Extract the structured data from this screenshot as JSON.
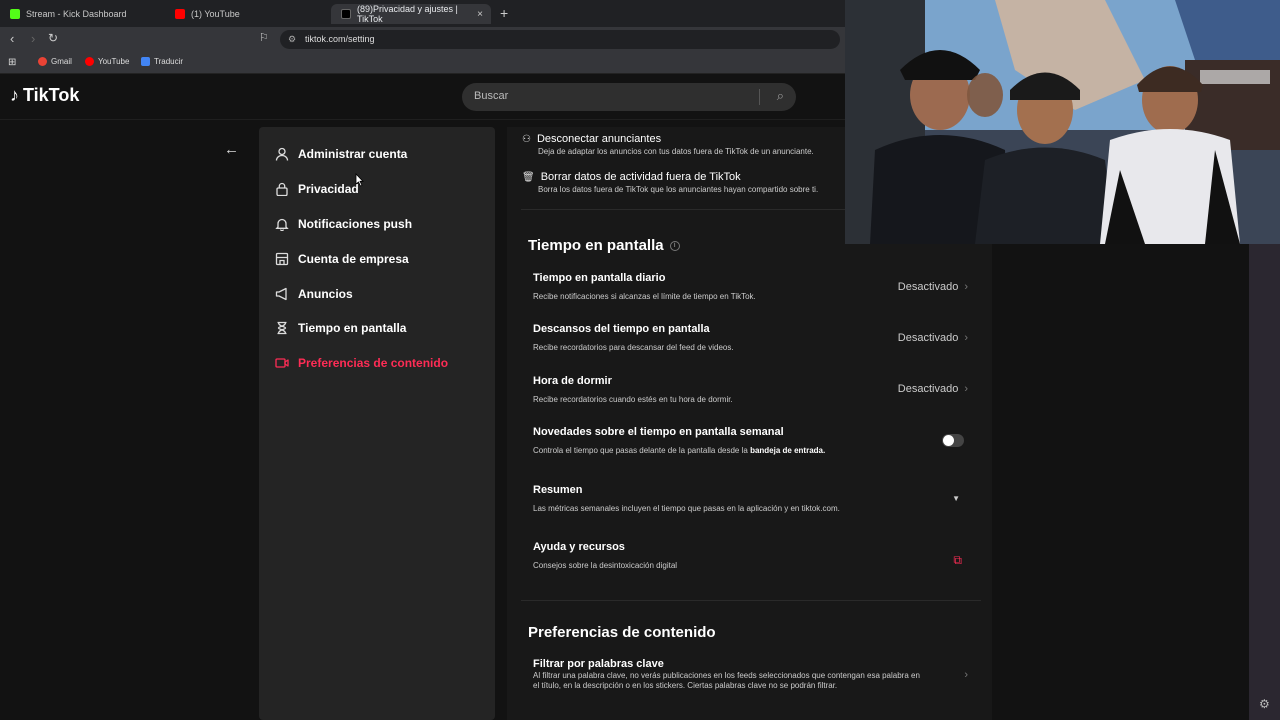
{
  "browser": {
    "tabs": [
      {
        "title": "Stream - Kick Dashboard",
        "color": "#53fc18"
      },
      {
        "title": "(1) YouTube",
        "color": "#ff0000"
      },
      {
        "title": "(89)Privacidad y ajustes | TikTok",
        "color": "#000000"
      }
    ],
    "new_tab": "+",
    "close": "×",
    "url": "tiktok.com/setting",
    "bookmarks": [
      {
        "label": "Gmail",
        "color": "#ea4335"
      },
      {
        "label": "YouTube",
        "color": "#ff0000"
      },
      {
        "label": "Traducir",
        "color": "#4285f4"
      }
    ]
  },
  "header": {
    "logo": "TikTok",
    "search_placeholder": "Buscar"
  },
  "sidebar": {
    "items": [
      {
        "label": "Administrar cuenta",
        "icon": "user-icon"
      },
      {
        "label": "Privacidad",
        "icon": "lock-icon"
      },
      {
        "label": "Notificaciones push",
        "icon": "bell-icon"
      },
      {
        "label": "Cuenta de empresa",
        "icon": "store-icon"
      },
      {
        "label": "Anuncios",
        "icon": "megaphone-icon"
      },
      {
        "label": "Tiempo en pantalla",
        "icon": "hourglass-icon"
      },
      {
        "label": "Preferencias de contenido",
        "icon": "video-icon",
        "active": true
      }
    ]
  },
  "ads": {
    "disconnect_title": "Desconectar anunciantes",
    "disconnect_desc": "Deja de adaptar los anuncios con tus datos fuera de TikTok de un anunciante.",
    "delete_title": "Borrar datos de actividad fuera de TikTok",
    "delete_desc": "Borra los datos fuera de TikTok que los anunciantes hayan compartido sobre ti."
  },
  "screen_time": {
    "heading": "Tiempo en pantalla",
    "daily_title": "Tiempo en pantalla diario",
    "daily_desc": "Recibe notificaciones si alcanzas el límite de tiempo en TikTok.",
    "daily_value": "Desactivado",
    "breaks_title": "Descansos del tiempo en pantalla",
    "breaks_desc": "Recibe recordatorios para descansar del feed de videos.",
    "breaks_value": "Desactivado",
    "sleep_title": "Hora de dormir",
    "sleep_desc": "Recibe recordatorios cuando estés en tu hora de dormir.",
    "sleep_value": "Desactivado",
    "weekly_title": "Novedades sobre el tiempo en pantalla semanal",
    "weekly_desc": "Controla el tiempo que pasas delante de la pantalla desde la",
    "weekly_desc_bold": "bandeja de entrada.",
    "summary_title": "Resumen",
    "summary_desc": "Las métricas semanales incluyen el tiempo que pasas en la aplicación y en tiktok.com.",
    "help_title": "Ayuda y recursos",
    "help_desc": "Consejos sobre la desintoxicación digital"
  },
  "content_prefs": {
    "heading": "Preferencias de contenido",
    "filter_title": "Filtrar por palabras clave",
    "filter_desc": "Al filtrar una palabra clave, no verás publicaciones en los feeds seleccionados que contengan esa palabra en el título, en la descripción o en los stickers. Ciertas palabras clave no se podrán filtrar."
  },
  "colors": {
    "accent": "#fe2c55",
    "panel": "#242424",
    "background": "#121212"
  }
}
